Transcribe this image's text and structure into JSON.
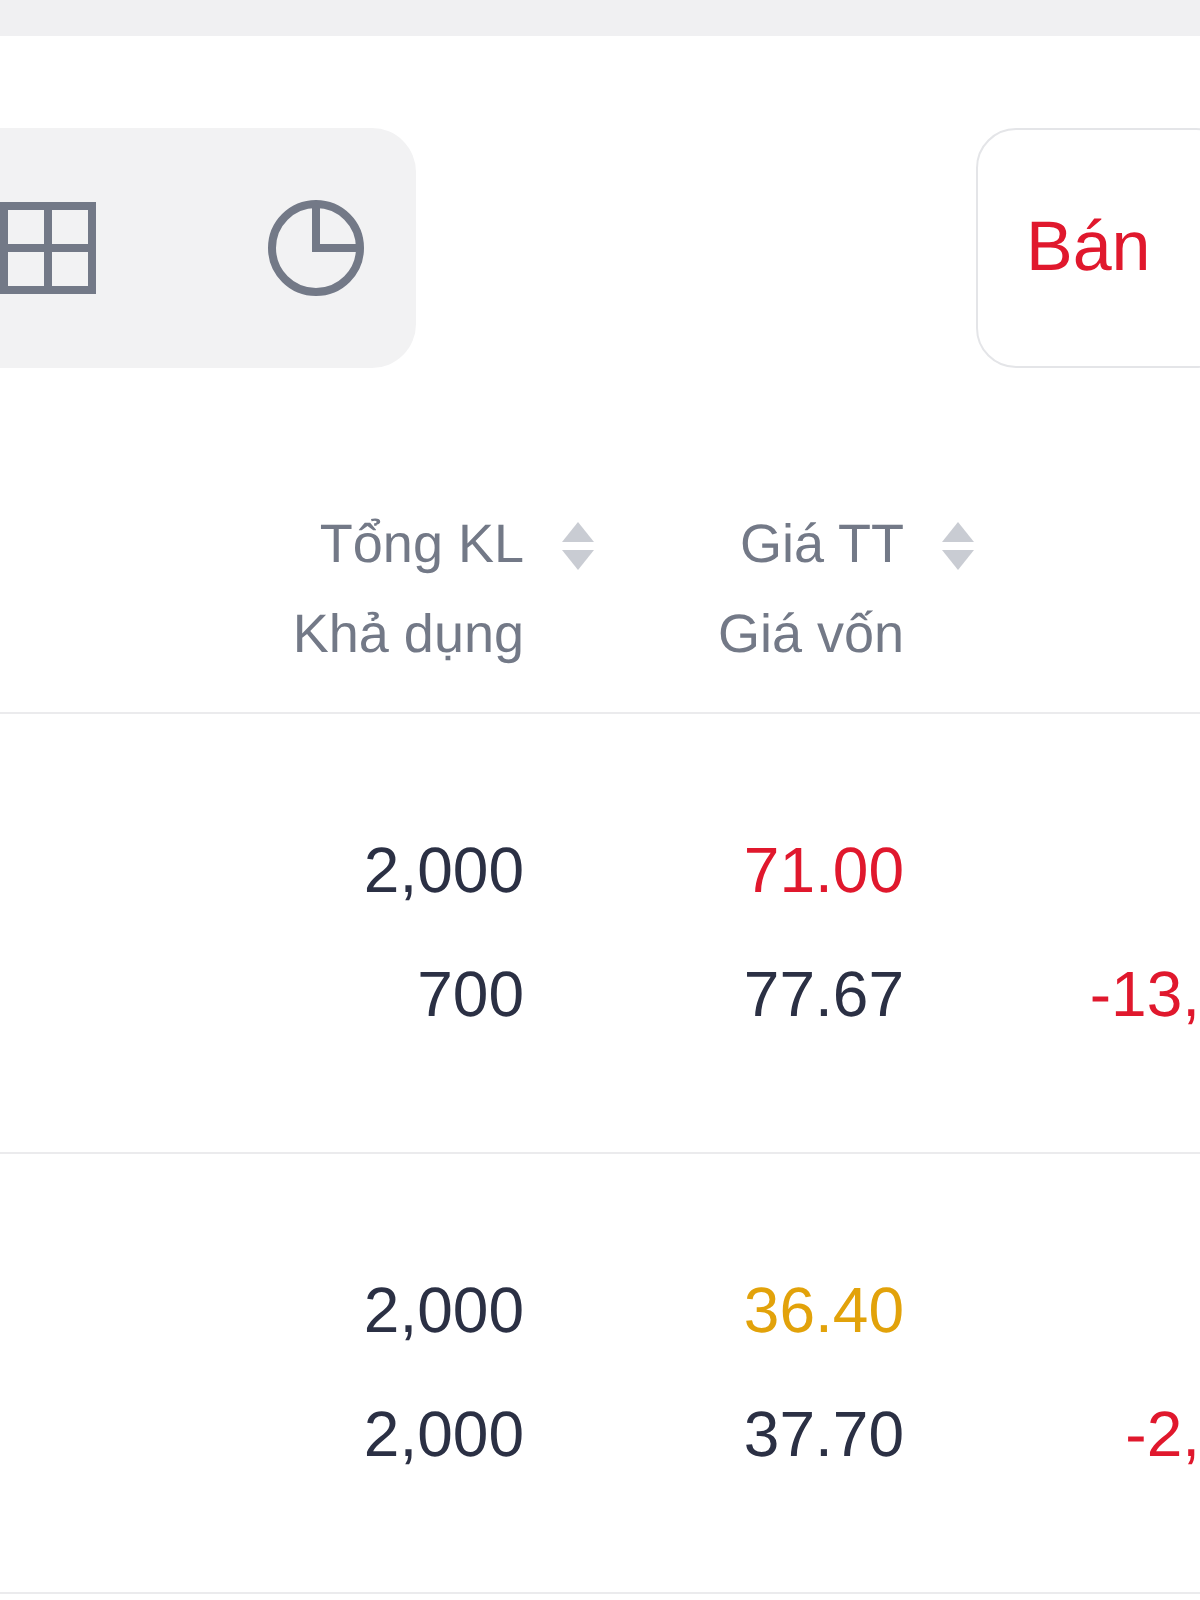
{
  "sell_button": {
    "label": "Bán"
  },
  "columns": [
    {
      "title": "Tổng KL",
      "subtitle": "Khả dụng",
      "sortable": true
    },
    {
      "title": "Giá TT",
      "subtitle": "Giá vốn",
      "sortable": true
    }
  ],
  "rows": [
    {
      "total_qty": "2,000",
      "available_qty": "700",
      "market_price": {
        "text": "71.00",
        "color": "#e0182d"
      },
      "cost_price": "77.67",
      "pnl": {
        "text": "-13,",
        "color": "#e0182d"
      }
    },
    {
      "total_qty": "2,000",
      "available_qty": "2,000",
      "market_price": {
        "text": "36.40",
        "color": "#e2a20a"
      },
      "cost_price": "37.70",
      "pnl": {
        "text": "-2,",
        "color": "#e0182d"
      }
    }
  ]
}
